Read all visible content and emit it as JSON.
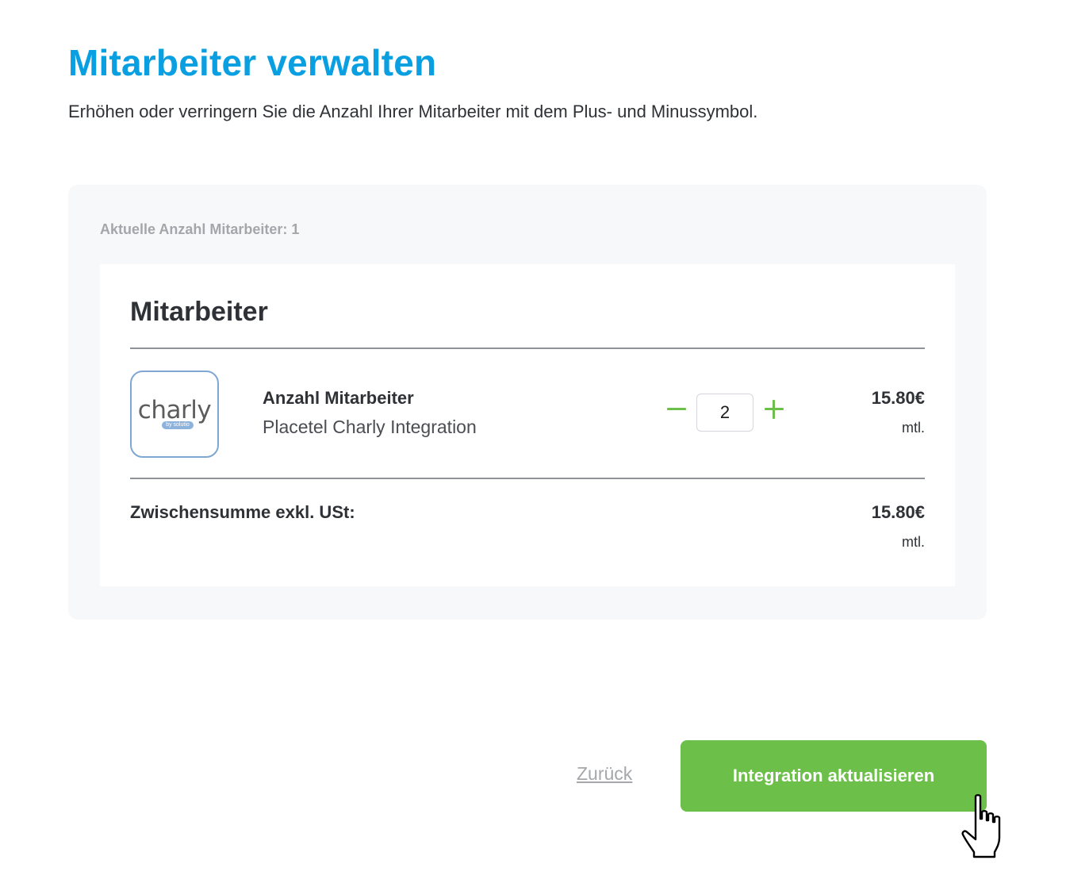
{
  "header": {
    "title": "Mitarbeiter verwalten",
    "subtitle": "Erhöhen oder verringern Sie die Anzahl Ihrer Mitarbeiter mit dem Plus- und Minussymbol."
  },
  "panel": {
    "current_count_label": "Aktuelle Anzahl Mitarbeiter: 1",
    "card": {
      "title": "Mitarbeiter",
      "item": {
        "logo": {
          "word": "charly",
          "badge": "by solutio",
          "icon": "charly-logo"
        },
        "name": "Anzahl Mitarbeiter",
        "description": "Placetel Charly Integration",
        "quantity": "2",
        "decrease_icon": "minus-icon",
        "increase_icon": "plus-icon",
        "price": "15.80€",
        "period": "mtl."
      },
      "subtotal": {
        "label": "Zwischensumme exkl. USt:",
        "price": "15.80€",
        "period": "mtl."
      }
    }
  },
  "footer": {
    "back_label": "Zurück",
    "submit_label": "Integration aktualisieren",
    "cursor_icon": "hand-pointer-icon"
  },
  "colors": {
    "title_blue": "#0a9fe0",
    "accent_green": "#6cc04a",
    "panel_bg": "#f7f8f9",
    "muted_text": "#a3a6aa"
  }
}
